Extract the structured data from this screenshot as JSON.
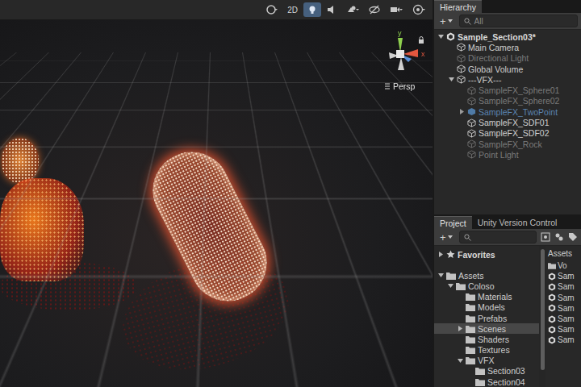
{
  "scene_view": {
    "toolbar": [
      {
        "kind": "shading",
        "label": "",
        "selected": false
      },
      {
        "kind": "text",
        "label": "2D",
        "selected": false
      },
      {
        "kind": "lighting",
        "label": "",
        "selected": true
      },
      {
        "kind": "audio",
        "label": "",
        "selected": false
      },
      {
        "kind": "effects",
        "label": "",
        "selected": false
      },
      {
        "kind": "visibility",
        "label": "",
        "selected": false
      },
      {
        "kind": "camera",
        "label": "",
        "selected": false
      },
      {
        "kind": "gizmos",
        "label": "",
        "selected": false
      }
    ],
    "gizmo": {
      "axes": [
        {
          "label": "y",
          "color": "#8fd14f"
        },
        {
          "label": "x",
          "color": "#e2573f"
        }
      ],
      "projection": "Persp"
    }
  },
  "hierarchy": {
    "tab": "Hierarchy",
    "add_button": "+",
    "search": {
      "placeholder": "All"
    },
    "items": [
      {
        "label": "Sample_Section03*",
        "depth": 0,
        "kind": "scene",
        "enabled": true,
        "has_children": true,
        "expanded": true
      },
      {
        "label": "Main Camera",
        "depth": 1,
        "kind": "object",
        "enabled": true,
        "has_children": false,
        "expanded": false
      },
      {
        "label": "Directional Light",
        "depth": 1,
        "kind": "object",
        "enabled": false,
        "has_children": false,
        "expanded": false
      },
      {
        "label": "Global Volume",
        "depth": 1,
        "kind": "object",
        "enabled": true,
        "has_children": false,
        "expanded": false
      },
      {
        "label": "---VFX---",
        "depth": 1,
        "kind": "object",
        "enabled": true,
        "has_children": true,
        "expanded": true
      },
      {
        "label": "SampleFX_Sphere01",
        "depth": 2,
        "kind": "object",
        "enabled": false,
        "has_children": false,
        "expanded": false
      },
      {
        "label": "SampleFX_Sphere02",
        "depth": 2,
        "kind": "object",
        "enabled": false,
        "has_children": false,
        "expanded": false
      },
      {
        "label": "SampleFX_TwoPoint",
        "depth": 2,
        "kind": "prefab",
        "enabled": false,
        "has_children": true,
        "expanded": false
      },
      {
        "label": "SampleFX_SDF01",
        "depth": 2,
        "kind": "object",
        "enabled": true,
        "has_children": false,
        "expanded": false
      },
      {
        "label": "SampleFX_SDF02",
        "depth": 2,
        "kind": "object",
        "enabled": true,
        "has_children": false,
        "expanded": false
      },
      {
        "label": "SampleFX_Rock",
        "depth": 2,
        "kind": "object",
        "enabled": false,
        "has_children": false,
        "expanded": false
      },
      {
        "label": "Point Light",
        "depth": 2,
        "kind": "object",
        "enabled": false,
        "has_children": false,
        "expanded": false
      }
    ]
  },
  "project": {
    "tabs": [
      {
        "label": "Project",
        "selected": true
      },
      {
        "label": "Unity Version Control",
        "selected": false
      }
    ],
    "add_button": "+",
    "tree": [
      {
        "label": "Favorites",
        "depth": 0,
        "kind": "favorites",
        "has_children": true,
        "expanded": false,
        "selected": false
      },
      {
        "label": "Assets",
        "depth": 0,
        "kind": "folder",
        "has_children": true,
        "expanded": true,
        "selected": false
      },
      {
        "label": "Coloso",
        "depth": 1,
        "kind": "folder",
        "has_children": true,
        "expanded": true,
        "selected": false
      },
      {
        "label": "Materials",
        "depth": 2,
        "kind": "folder",
        "has_children": false,
        "expanded": false,
        "selected": false
      },
      {
        "label": "Models",
        "depth": 2,
        "kind": "folder",
        "has_children": false,
        "expanded": false,
        "selected": false
      },
      {
        "label": "Prefabs",
        "depth": 2,
        "kind": "folder",
        "has_children": false,
        "expanded": false,
        "selected": false
      },
      {
        "label": "Scenes",
        "depth": 2,
        "kind": "folder",
        "has_children": true,
        "expanded": false,
        "selected": true
      },
      {
        "label": "Shaders",
        "depth": 2,
        "kind": "folder",
        "has_children": false,
        "expanded": false,
        "selected": false
      },
      {
        "label": "Textures",
        "depth": 2,
        "kind": "folder",
        "has_children": false,
        "expanded": false,
        "selected": false
      },
      {
        "label": "VFX",
        "depth": 2,
        "kind": "folder",
        "has_children": true,
        "expanded": true,
        "selected": false
      },
      {
        "label": "Section03",
        "depth": 3,
        "kind": "folder",
        "has_children": false,
        "expanded": false,
        "selected": false
      },
      {
        "label": "Section04",
        "depth": 3,
        "kind": "folder",
        "has_children": false,
        "expanded": false,
        "selected": false
      }
    ],
    "assets": {
      "header": "Assets",
      "items": [
        {
          "label": "Vo",
          "kind": "folder"
        },
        {
          "label": "Sam",
          "kind": "scene"
        },
        {
          "label": "Sam",
          "kind": "scene"
        },
        {
          "label": "Sam",
          "kind": "scene"
        },
        {
          "label": "Sam",
          "kind": "scene"
        },
        {
          "label": "Sam",
          "kind": "scene"
        },
        {
          "label": "Sam",
          "kind": "scene"
        },
        {
          "label": "Sam",
          "kind": "scene"
        }
      ]
    }
  }
}
